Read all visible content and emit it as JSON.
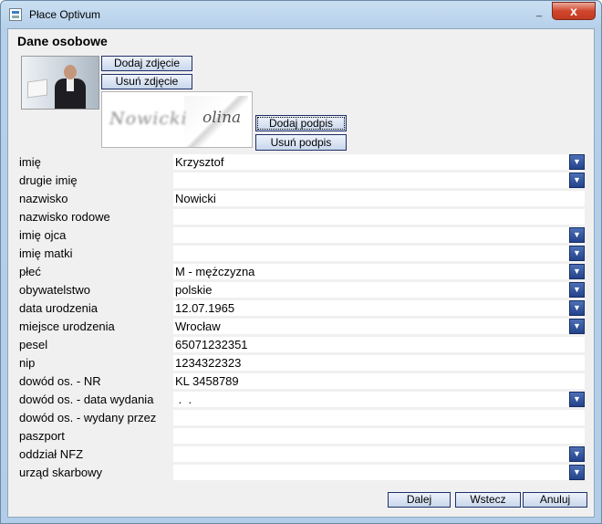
{
  "window": {
    "title": "Płace Optivum",
    "minimize_glyph": "_",
    "close_glyph": "x"
  },
  "section_title": "Dane osobowe",
  "photo_buttons": {
    "add": "Dodaj zdjęcie",
    "remove": "Usuń zdjęcie"
  },
  "signature_buttons": {
    "add": "Dodaj podpis",
    "remove": "Usuń podpis"
  },
  "fields": [
    {
      "label": "imię",
      "value": "Krzysztof",
      "dropdown": true
    },
    {
      "label": "drugie imię",
      "value": "",
      "dropdown": true
    },
    {
      "label": "nazwisko",
      "value": "Nowicki",
      "dropdown": false
    },
    {
      "label": "nazwisko rodowe",
      "value": "",
      "dropdown": false
    },
    {
      "label": "imię ojca",
      "value": "",
      "dropdown": true
    },
    {
      "label": "imię matki",
      "value": "",
      "dropdown": true
    },
    {
      "label": "płeć",
      "value": "M - mężczyzna",
      "dropdown": true
    },
    {
      "label": "obywatelstwo",
      "value": "polskie",
      "dropdown": true
    },
    {
      "label": "data urodzenia",
      "value": "12.07.1965",
      "dropdown": true
    },
    {
      "label": "miejsce urodzenia",
      "value": "Wrocław",
      "dropdown": true
    },
    {
      "label": "pesel",
      "value": "65071232351",
      "dropdown": false
    },
    {
      "label": "nip",
      "value": "1234322323",
      "dropdown": false
    },
    {
      "label": "dowód os. - NR",
      "value": "KL 3458789",
      "dropdown": false
    },
    {
      "label": "dowód os. - data wydania",
      "value": " .  .",
      "dropdown": true
    },
    {
      "label": "dowód os. - wydany przez",
      "value": "",
      "dropdown": false
    },
    {
      "label": "paszport",
      "value": "",
      "dropdown": false
    },
    {
      "label": "oddział NFZ",
      "value": "",
      "dropdown": true
    },
    {
      "label": "urząd skarbowy",
      "value": "",
      "dropdown": true
    }
  ],
  "footer": {
    "next": "Dalej",
    "back": "Wstecz",
    "cancel": "Anuluj"
  },
  "icons": {
    "dropdown": "chevron-down-icon",
    "app": "app-icon"
  },
  "colors": {
    "titlebar": "#b6d0ea",
    "dropdown_button": "#23428a",
    "close_button": "#c23b22"
  }
}
